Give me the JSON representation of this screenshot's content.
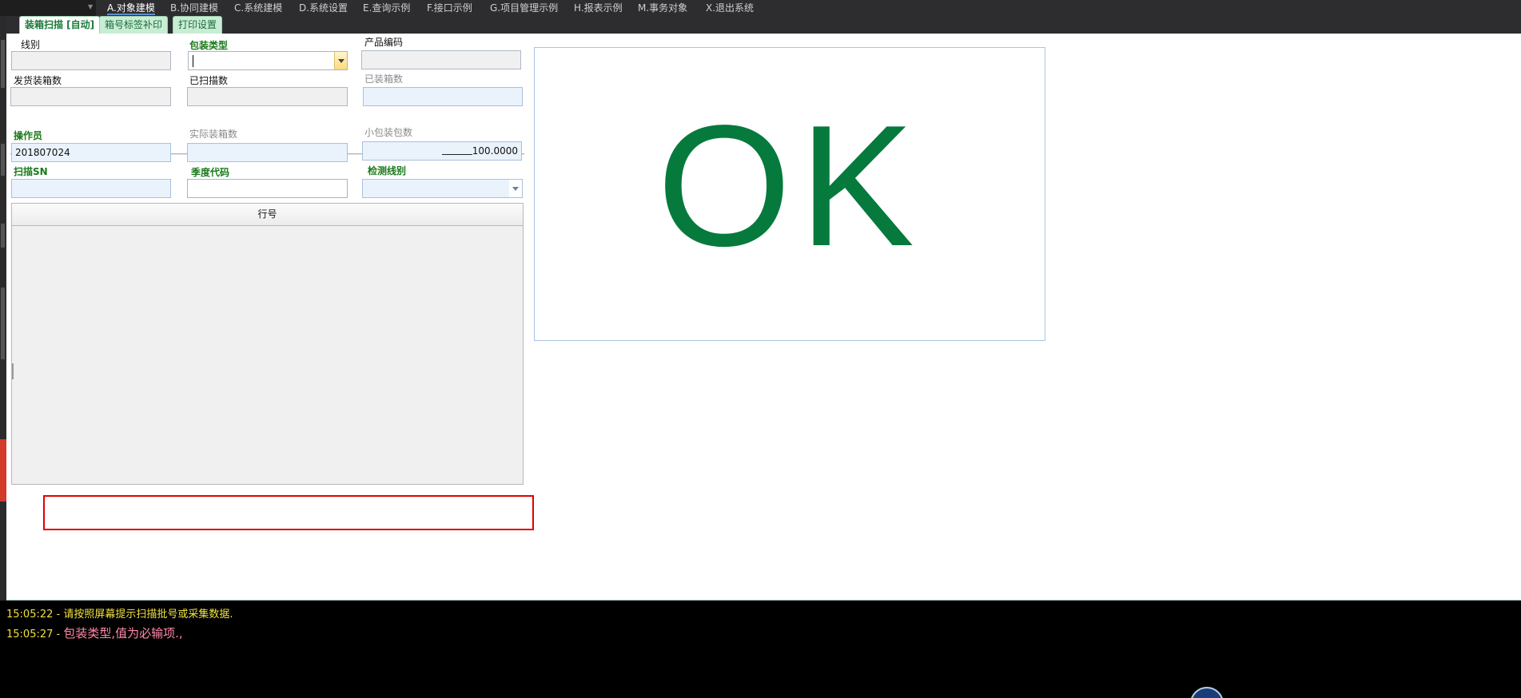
{
  "menu": {
    "items": [
      {
        "label": "A.对象建模",
        "active": true
      },
      {
        "label": "B.协同建模"
      },
      {
        "label": "C.系统建模"
      },
      {
        "label": "D.系统设置"
      },
      {
        "label": "E.查询示例"
      },
      {
        "label": "F.接口示例"
      },
      {
        "label": "G.项目管理示例"
      },
      {
        "label": "H.报表示例"
      },
      {
        "label": "M.事务对象"
      },
      {
        "label": "X.退出系统"
      }
    ]
  },
  "tabs": [
    {
      "label": "装箱扫描 [自动]",
      "active": true
    },
    {
      "label": "箱号标签补印"
    },
    {
      "label": "打印设置"
    }
  ],
  "form": {
    "line_label": "线别",
    "line_value": "",
    "package_type_label": "包装类型",
    "package_type_value": "",
    "product_code_label": "产品编码",
    "product_code_value": "",
    "ship_box_count_label": "发货装箱数",
    "ship_box_count_value": "",
    "scanned_count_label": "已扫描数",
    "scanned_count_value": "",
    "packed_box_count_label": "已装箱数",
    "packed_box_count_value": "",
    "operator_label": "操作员",
    "operator_value": "201807024",
    "actual_box_count_label": "实际装箱数",
    "actual_box_count_value": "",
    "small_pack_count_label": "小包装包数",
    "small_pack_count_value": "100.0000",
    "scan_sn_label": "扫描SN",
    "scan_sn_value": "",
    "season_code_label": "季度代码",
    "season_code_value": "",
    "detect_line_label": "检测线别",
    "detect_line_value": ""
  },
  "grid": {
    "columns": [
      "行号"
    ]
  },
  "status_panel": {
    "text": "OK",
    "color": "#057a3c"
  },
  "log": [
    {
      "time": "15:05:22",
      "sep": " - ",
      "message": "请按照屏幕提示扫描批号或采集数据."
    },
    {
      "time": "15:05:27",
      "sep": " - ",
      "message": "包装类型,值为必输项.,"
    }
  ]
}
